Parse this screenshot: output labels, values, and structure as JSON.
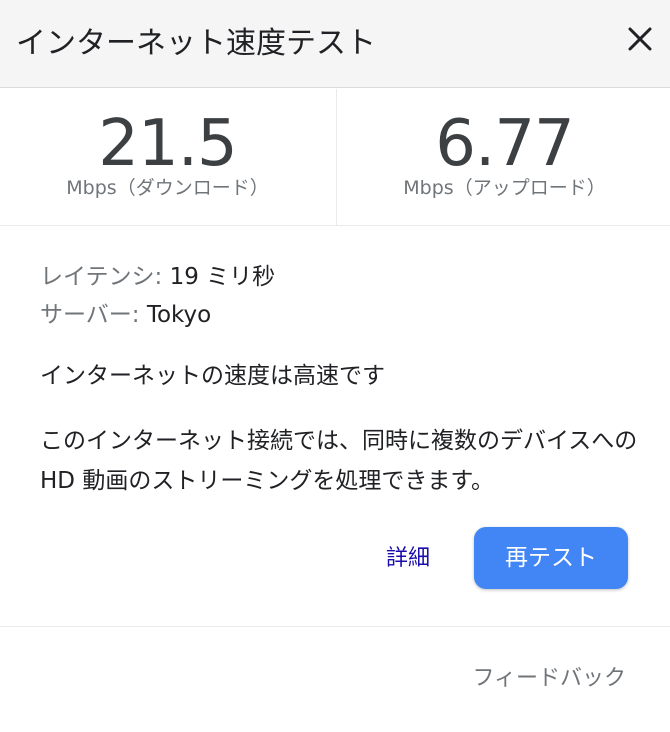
{
  "header": {
    "title": "インターネット速度テスト",
    "close_icon": "close-icon"
  },
  "download": {
    "value": "21.5",
    "unit": "Mbps（ダウンロード）"
  },
  "upload": {
    "value": "6.77",
    "unit": "Mbps（アップロード）"
  },
  "latency": {
    "label": "レイテンシ:",
    "value": "19 ミリ秒"
  },
  "server": {
    "label": "サーバー:",
    "value": "Tokyo"
  },
  "status_text": "インターネットの速度は高速です",
  "description": "このインターネット接続では、同時に複数のデバイスへの HD 動画のストリーミングを処理できます。",
  "actions": {
    "details_label": "詳細",
    "retest_label": "再テスト"
  },
  "feedback_label": "フィードバック",
  "colors": {
    "accent": "#4285f4",
    "link": "#1a0dab",
    "header_bg": "#f5f5f5"
  }
}
